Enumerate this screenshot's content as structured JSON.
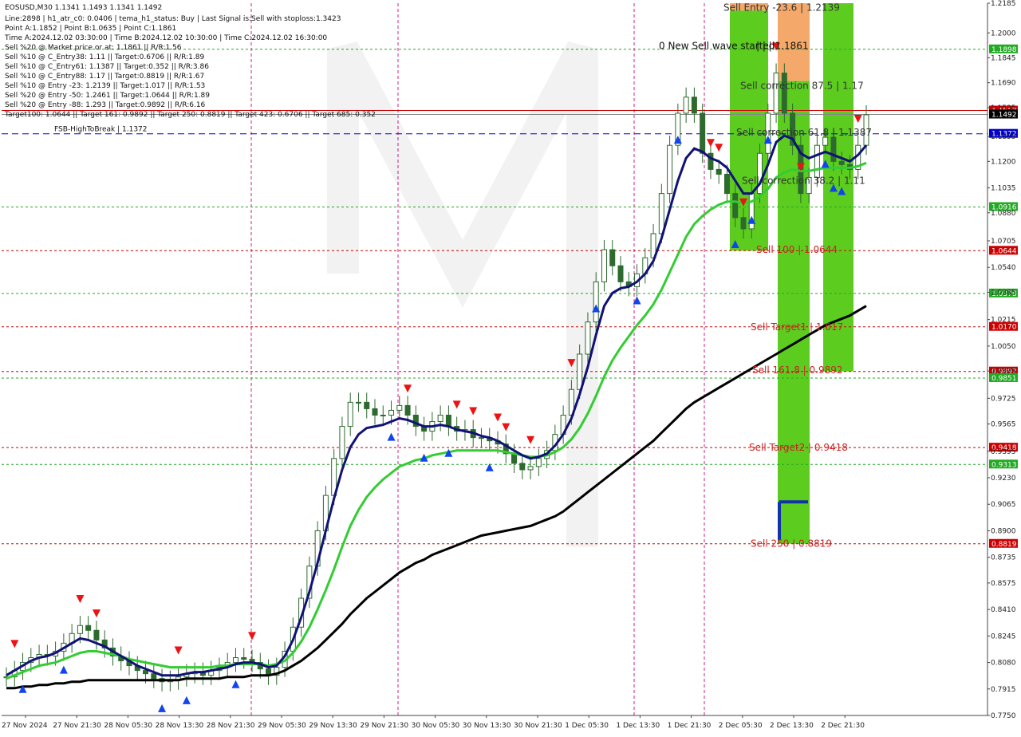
{
  "chart_data": {
    "type": "line",
    "symbol_header": "EOSUSD,M30  1.1341 1.1493 1.1341 1.1492",
    "info_lines": [
      "Line:2898 | h1_atr_c0: 0.0406 | tema_h1_status: Buy | Last Signal is:Sell with stoploss:1.3423",
      "Point A:1.1852 | Point B:1.0635 | Point C:1.1861",
      "Time A:2024.12.02 03:30:00 | Time B:2024.12.02 10:30:00 | Time C:2024.12.02 16:30:00",
      "Sell %20 @ Market price or at: 1.1861 || R/R:1.56",
      "Sell %10 @ C_Entry38: 1.11 || Target:0.6706 || R/R:1.89",
      "Sell %10 @ C_Entry61: 1.1387 || Target:0.352 || R/R:3.86",
      "Sell %10 @ C_Entry88: 1.17 || Target:0.8819 || R/R:1.67",
      "Sell %10 @ Entry -23: 1.2139 || Target:1.017 || R/R:1.53",
      "Sell %20 @ Entry -50: 1.2461 || Target:1.0644 || R/R:1.89",
      "Sell %20 @ Entry -88: 1.293 || Target:0.9892 || R/R:6.16"
    ],
    "targets_line": "Target100: 1.0644 || Target 161: 0.9892 || Target 250: 0.8819 || Target 423: 0.6706 || Target 685: 0.352",
    "y_range": [
      0.775,
      1.2185
    ],
    "y_ticks": [
      "1.2185",
      "1.2000",
      "1.1845",
      "1.1690",
      "1.1535",
      "1.1355",
      "1.1200",
      "1.1035",
      "1.0880",
      "1.0705",
      "1.0540",
      "1.0385",
      "1.0215",
      "1.0050",
      "0.9895",
      "0.9725",
      "0.9565",
      "0.9395",
      "0.9230",
      "0.9065",
      "0.8900",
      "0.8735",
      "0.8575",
      "0.8410",
      "0.8245",
      "0.8080",
      "0.7915",
      "0.7750"
    ],
    "x_labels": [
      "27 Nov 2024",
      "27 Nov 21:30",
      "28 Nov 05:30",
      "28 Nov 13:30",
      "28 Nov 21:30",
      "29 Nov 05:30",
      "29 Nov 13:30",
      "29 Nov 21:30",
      "30 Nov 05:30",
      "30 Nov 13:30",
      "30 Nov 21:30",
      "1 Dec 05:30",
      "1 Dec 13:30",
      "1 Dec 21:30",
      "2 Dec 05:30",
      "2 Dec 13:30",
      "2 Dec 21:30"
    ],
    "levels": [
      {
        "value": 1.1898,
        "tag": "1.1898",
        "color": "#22aa22",
        "style": "dotted",
        "tag_bg": "#22aa22"
      },
      {
        "value": 1.1517,
        "tag": "1.1517",
        "color": "#cc0000",
        "style": "solid",
        "tag_bg": "#cc0000"
      },
      {
        "value": 1.1492,
        "tag": "1.1492",
        "color": "#888888",
        "style": "solid",
        "tag_bg": "#000000"
      },
      {
        "value": 1.1372,
        "tag": "1.1372",
        "color": "#0000cc",
        "style": "dashed",
        "tag_bg": "#0000cc",
        "label": "FSB-HighToBreak | 1.1372"
      },
      {
        "value": 1.0916,
        "tag": "1.0916",
        "color": "#22aa22",
        "style": "dotted",
        "tag_bg": "#22aa22"
      },
      {
        "value": 1.0644,
        "tag": "1.0644",
        "color": "#cc0000",
        "style": "dotted",
        "tag_bg": "#cc0000"
      },
      {
        "value": 1.0378,
        "tag": "1.0378",
        "color": "#22aa22",
        "style": "dotted",
        "tag_bg": "#22aa22"
      },
      {
        "value": 1.017,
        "tag": "1.0170",
        "color": "#cc0000",
        "style": "dotted",
        "tag_bg": "#cc0000"
      },
      {
        "value": 0.9892,
        "tag": "0.9892",
        "color": "#cc0000",
        "style": "dotted",
        "tag_bg": "#cc0000"
      },
      {
        "value": 0.9851,
        "tag": "0.9851",
        "color": "#22aa22",
        "style": "dotted",
        "tag_bg": "#22aa22"
      },
      {
        "value": 0.9418,
        "tag": "0.9418",
        "color": "#cc0000",
        "style": "dotted",
        "tag_bg": "#cc0000"
      },
      {
        "value": 0.9313,
        "tag": "0.9313",
        "color": "#22aa22",
        "style": "dotted",
        "tag_bg": "#22aa22"
      },
      {
        "value": 0.8819,
        "tag": "0.8819",
        "color": "#cc0000",
        "style": "dotted",
        "tag_bg": "#cc0000"
      }
    ],
    "annotations": [
      {
        "text": "Sell Entry -23.6 | 1.2139",
        "value": 1.2139,
        "color": "#333333"
      },
      {
        "text": "0 New Sell wave started",
        "value": 1.19,
        "color": "#111111"
      },
      {
        "text": "| | | 1.1861",
        "value": 1.19,
        "color": "#111111"
      },
      {
        "text": "Sell correction 87.5 | 1.17",
        "value": 1.165,
        "color": "#333333"
      },
      {
        "text": "Sell correction 61.8 | 1.1387",
        "value": 1.136,
        "color": "#333333"
      },
      {
        "text": "Sell correction 38.2 | 1.11",
        "value": 1.106,
        "color": "#333333"
      },
      {
        "text": "Sell 100 | 1.0644",
        "value": 1.063,
        "color": "#cc2222"
      },
      {
        "text": "Sell Target1 | 1.017",
        "value": 1.015,
        "color": "#cc2222"
      },
      {
        "text": "Sell 161.8 | 0.9892",
        "value": 0.988,
        "color": "#cc2222"
      },
      {
        "text": "Sell Target2 | 0.9418",
        "value": 0.94,
        "color": "#cc2222"
      },
      {
        "text": "Sell 250 | 0.8819",
        "value": 0.88,
        "color": "#cc2222"
      }
    ],
    "close_series": [
      0.799,
      0.803,
      0.808,
      0.811,
      0.813,
      0.812,
      0.815,
      0.82,
      0.826,
      0.831,
      0.828,
      0.822,
      0.817,
      0.812,
      0.809,
      0.806,
      0.803,
      0.801,
      0.798,
      0.796,
      0.797,
      0.799,
      0.801,
      0.802,
      0.8,
      0.803,
      0.805,
      0.808,
      0.811,
      0.81,
      0.808,
      0.804,
      0.8,
      0.805,
      0.815,
      0.83,
      0.848,
      0.868,
      0.89,
      0.912,
      0.935,
      0.955,
      0.97,
      0.97,
      0.966,
      0.962,
      0.962,
      0.965,
      0.968,
      0.962,
      0.955,
      0.952,
      0.958,
      0.962,
      0.955,
      0.952,
      0.953,
      0.948,
      0.948,
      0.946,
      0.944,
      0.938,
      0.932,
      0.928,
      0.93,
      0.935,
      0.94,
      0.95,
      0.962,
      0.978,
      1.0,
      1.02,
      1.045,
      1.065,
      1.055,
      1.045,
      1.042,
      1.05,
      1.06,
      1.075,
      1.1,
      1.13,
      1.15,
      1.16,
      1.15,
      1.125,
      1.115,
      1.112,
      1.1,
      1.085,
      1.078,
      1.1,
      1.125,
      1.15,
      1.175,
      1.15,
      1.13,
      1.1,
      1.11,
      1.13,
      1.135,
      1.12,
      1.118,
      1.115,
      1.13,
      1.149
    ],
    "ema_fast": [
      0.8,
      0.803,
      0.806,
      0.809,
      0.811,
      0.812,
      0.814,
      0.817,
      0.82,
      0.823,
      0.822,
      0.82,
      0.818,
      0.815,
      0.812,
      0.809,
      0.806,
      0.804,
      0.802,
      0.8,
      0.8,
      0.8,
      0.801,
      0.802,
      0.802,
      0.803,
      0.804,
      0.805,
      0.807,
      0.808,
      0.808,
      0.807,
      0.805,
      0.806,
      0.812,
      0.822,
      0.836,
      0.852,
      0.87,
      0.89,
      0.91,
      0.928,
      0.942,
      0.95,
      0.954,
      0.955,
      0.956,
      0.958,
      0.96,
      0.959,
      0.957,
      0.955,
      0.955,
      0.956,
      0.955,
      0.953,
      0.952,
      0.951,
      0.949,
      0.948,
      0.946,
      0.943,
      0.94,
      0.937,
      0.935,
      0.936,
      0.938,
      0.943,
      0.95,
      0.96,
      0.975,
      0.992,
      1.012,
      1.03,
      1.038,
      1.041,
      1.042,
      1.045,
      1.05,
      1.058,
      1.072,
      1.09,
      1.108,
      1.122,
      1.128,
      1.126,
      1.122,
      1.12,
      1.116,
      1.108,
      1.1,
      1.1,
      1.106,
      1.118,
      1.132,
      1.136,
      1.134,
      1.125,
      1.122,
      1.124,
      1.126,
      1.124,
      1.122,
      1.12,
      1.124,
      1.13
    ],
    "ema_mid": [
      0.798,
      0.8,
      0.802,
      0.804,
      0.806,
      0.807,
      0.808,
      0.81,
      0.812,
      0.814,
      0.815,
      0.815,
      0.814,
      0.813,
      0.812,
      0.81,
      0.809,
      0.808,
      0.807,
      0.806,
      0.805,
      0.805,
      0.805,
      0.805,
      0.805,
      0.805,
      0.806,
      0.806,
      0.807,
      0.807,
      0.807,
      0.807,
      0.806,
      0.807,
      0.809,
      0.814,
      0.821,
      0.83,
      0.841,
      0.853,
      0.866,
      0.88,
      0.893,
      0.903,
      0.911,
      0.917,
      0.922,
      0.926,
      0.93,
      0.932,
      0.934,
      0.935,
      0.937,
      0.938,
      0.939,
      0.94,
      0.94,
      0.94,
      0.94,
      0.94,
      0.94,
      0.939,
      0.938,
      0.937,
      0.936,
      0.936,
      0.937,
      0.939,
      0.942,
      0.947,
      0.954,
      0.963,
      0.974,
      0.986,
      0.996,
      1.004,
      1.011,
      1.018,
      1.024,
      1.031,
      1.04,
      1.051,
      1.062,
      1.073,
      1.081,
      1.086,
      1.09,
      1.093,
      1.095,
      1.095,
      1.094,
      1.095,
      1.098,
      1.103,
      1.11,
      1.113,
      1.115,
      1.114,
      1.114,
      1.115,
      1.116,
      1.116,
      1.116,
      1.116,
      1.117,
      1.119
    ],
    "sma_slow": [
      0.792,
      0.792,
      0.793,
      0.793,
      0.794,
      0.794,
      0.795,
      0.795,
      0.796,
      0.796,
      0.797,
      0.797,
      0.797,
      0.797,
      0.797,
      0.797,
      0.797,
      0.797,
      0.797,
      0.797,
      0.797,
      0.797,
      0.798,
      0.798,
      0.798,
      0.798,
      0.798,
      0.799,
      0.799,
      0.799,
      0.8,
      0.8,
      0.8,
      0.801,
      0.803,
      0.806,
      0.809,
      0.813,
      0.817,
      0.822,
      0.827,
      0.832,
      0.838,
      0.843,
      0.848,
      0.852,
      0.856,
      0.86,
      0.864,
      0.867,
      0.87,
      0.872,
      0.875,
      0.877,
      0.879,
      0.881,
      0.883,
      0.885,
      0.887,
      0.888,
      0.889,
      0.89,
      0.891,
      0.892,
      0.893,
      0.895,
      0.897,
      0.899,
      0.902,
      0.906,
      0.91,
      0.914,
      0.918,
      0.922,
      0.926,
      0.93,
      0.934,
      0.938,
      0.942,
      0.946,
      0.951,
      0.956,
      0.961,
      0.966,
      0.97,
      0.973,
      0.976,
      0.979,
      0.982,
      0.985,
      0.988,
      0.991,
      0.994,
      0.997,
      1.0,
      1.003,
      1.006,
      1.009,
      1.012,
      1.015,
      1.018,
      1.02,
      1.022,
      1.024,
      1.027,
      1.03
    ],
    "sell_arrow_indices": [
      1,
      9,
      11,
      21,
      30,
      49,
      55,
      57,
      60,
      61,
      64,
      69,
      86,
      87,
      90,
      94,
      97,
      104
    ],
    "buy_arrow_indices": [
      2,
      7,
      19,
      22,
      28,
      47,
      51,
      54,
      59,
      72,
      77,
      82,
      89,
      91,
      93,
      100,
      101,
      102
    ]
  }
}
